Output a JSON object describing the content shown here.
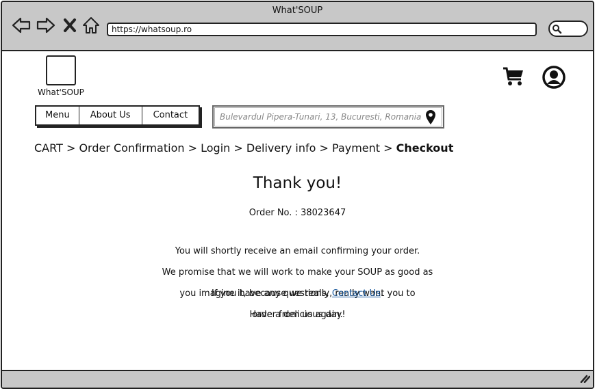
{
  "window": {
    "title": "What'SOUP"
  },
  "browser": {
    "url": "https://whatsoup.ro",
    "buttons": [
      "back-arrow-icon",
      "forward-arrow-icon",
      "close-x-icon",
      "home-icon"
    ],
    "search_icon": "search-icon"
  },
  "header": {
    "logo_text": "What'SOUP",
    "cart_icon": "shopping-cart-icon",
    "account_icon": "user-account-icon"
  },
  "nav": {
    "items": [
      {
        "label": "Menu"
      },
      {
        "label": "About Us"
      },
      {
        "label": "Contact"
      }
    ]
  },
  "address": {
    "text": "Bulevardul Pipera-Tunari, 13, Bucuresti, Romania",
    "icon": "location-pin-icon"
  },
  "breadcrumb": {
    "steps": [
      "CART",
      "Order Confirmation",
      "Login",
      "Delivery info",
      "Payment"
    ],
    "separator": ">",
    "current": "Checkout"
  },
  "confirmation": {
    "title": "Thank you!",
    "order_label": "Order No. :",
    "order_number": "38023647",
    "message_lines": [
      "You will shortly receive an email confirming your order.",
      "We promise that we will work to make your SOUP as good as",
      "you imagine it, because we really, really want you to",
      "order from us again."
    ],
    "questions_prefix": "If you have any questions,",
    "contact_link": "Contact Us",
    "questions_suffix": ".",
    "closing": "Have a delicious day!"
  }
}
